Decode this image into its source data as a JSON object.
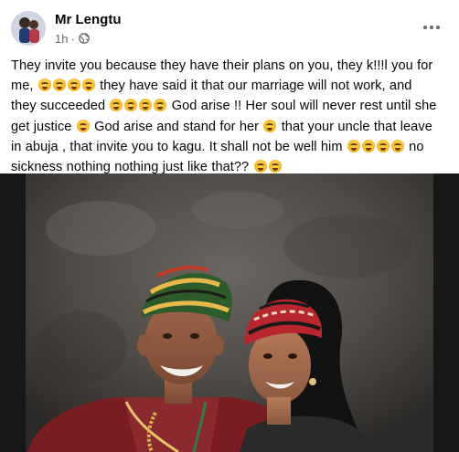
{
  "post": {
    "author": "Mr Lengtu",
    "timestamp": "1h",
    "audience_icon": "globe-icon",
    "more_icon": "more-options-icon",
    "text_lines": [
      "They invite you because they have their plans on you, they k!!!l you for",
      {
        "pre": "me, ",
        "emoji_count": 4,
        "post": " they have  said it that our marriage will not work, and"
      },
      {
        "pre": "they succeeded ",
        "emoji_count": 4,
        "post": " God arise !! Her soul will never rest until she"
      },
      {
        "pre": "get  justice ",
        "emoji_count": 1,
        "post": " God arise and stand for her ",
        "emoji_count2": 1,
        "post2": " that your uncle that leave"
      },
      {
        "pre": "in abuja , that invite you to kagu. It shall not be well him ",
        "emoji_count": 4,
        "post": " no"
      },
      {
        "pre": "sickness nothing nothing just like that?? ",
        "emoji_count": 2,
        "post": ""
      }
    ],
    "emoji_icon": "crying-face-emoji"
  },
  "colors": {
    "text": "#050505",
    "meta": "#65676b",
    "background": "#ffffff",
    "photo_frame": "#151515",
    "backdrop": "#54504d"
  }
}
